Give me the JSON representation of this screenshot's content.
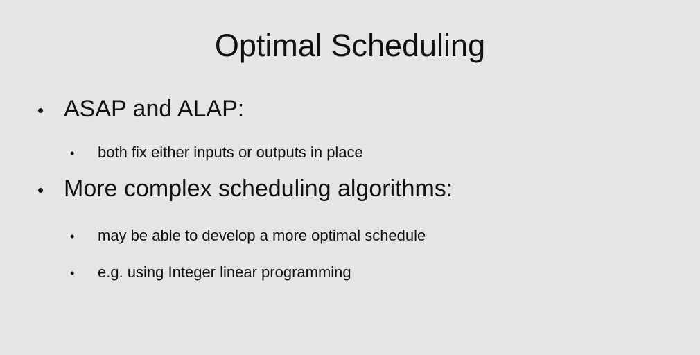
{
  "slide": {
    "title": "Optimal Scheduling",
    "bullet_glyph": "•",
    "items": [
      {
        "label": "ASAP and ALAP:",
        "subitems": [
          "both fix either inputs or outputs in place"
        ]
      },
      {
        "label": "More complex scheduling algorithms:",
        "subitems": [
          "may be able to develop a more optimal schedule",
          "e.g. using Integer linear programming"
        ]
      }
    ]
  }
}
